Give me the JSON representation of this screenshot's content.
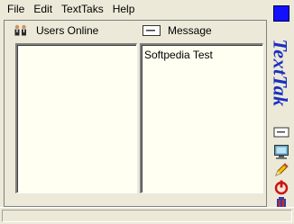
{
  "menu": [
    "File",
    "Edit",
    "TextTaks",
    "Help"
  ],
  "brand": "TextTak",
  "panes": {
    "users_label": "Users Online",
    "message_label": "Message"
  },
  "message_text": "Softpedia Test",
  "colors": {
    "window_bg": "#ece9d8",
    "pane_bg": "#fffff2",
    "brand": "#1a2fbf",
    "blue_square": "#1111ff"
  },
  "icons": {
    "users": "users-icon",
    "message": "envelope-icon",
    "side": [
      "envelope-icon",
      "monitor-icon",
      "pencil-icon",
      "power-icon",
      "trash-icon"
    ]
  },
  "status": ""
}
